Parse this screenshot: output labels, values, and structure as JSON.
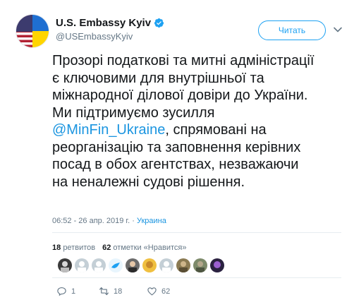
{
  "tweet": {
    "display_name": "U.S. Embassy Kyiv",
    "handle": "@USEmbassyKyiv",
    "follow_label": "Читать",
    "text_before_mention": "Прозорі податкові та митні адміністрації є ключовими для внутрішньої та міжнародної ділової довіри до України. Ми підтримуємо зусилля ",
    "mention": "@MinFin_Ukraine",
    "text_after_mention": ", спрямовані на реорганізацію та заповнення керівних посад в обох агентствах, незважаючи на неналежні судові рішення.",
    "timestamp": "06:52 - 26 апр. 2019 г.",
    "location": "Украина"
  },
  "stats": {
    "retweets_count": "18",
    "retweets_label": "ретвитов",
    "likes_count": "62",
    "likes_label": "отметки «Нравится»"
  },
  "actions": {
    "reply_count": "1",
    "retweet_count": "18",
    "like_count": "62"
  },
  "colors": {
    "accent": "#1da1f2",
    "link": "#1b95e0",
    "muted": "#657786"
  }
}
